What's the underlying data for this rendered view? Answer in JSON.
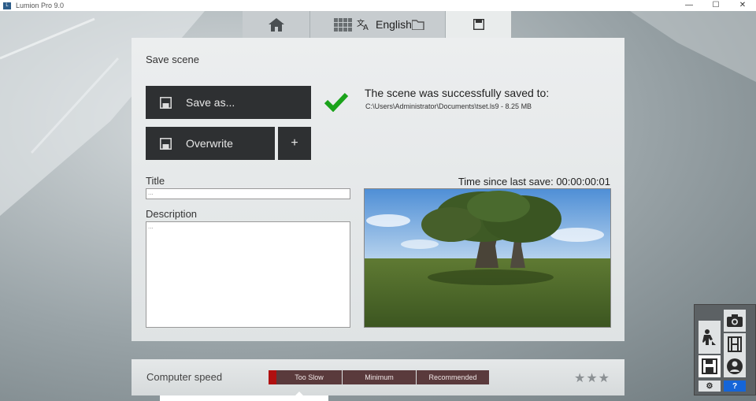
{
  "window": {
    "title": "Lumion Pro 9.0",
    "app_icon": "lumion-app-icon",
    "controls": [
      "—",
      "☐",
      "✕"
    ]
  },
  "tabs": {
    "home_icon": "home-icon",
    "files_icon": "files-grid-icon",
    "language_label": "English",
    "save_icon": "floppy-disk-icon"
  },
  "save_panel": {
    "heading": "Save scene",
    "save_as_label": "Save as...",
    "overwrite_label": "Overwrite",
    "plus_label": "+",
    "success_message": "The scene was successfully saved to:",
    "saved_path": "C:\\Users\\Administrator\\Documents\\tset.ls9 - 8.25 MB",
    "title_label": "Title",
    "title_placeholder": "...",
    "description_label": "Description",
    "description_placeholder": "...",
    "time_since_save": "Time since last save: 00:00:00:01",
    "success_color": "#1aa31a"
  },
  "speed_bar": {
    "label": "Computer speed",
    "segments": [
      "Too Slow",
      "Minimum",
      "Recommended"
    ],
    "stars": "★★★"
  },
  "palette": {
    "help_label": "?",
    "accent": "#1565d8"
  }
}
